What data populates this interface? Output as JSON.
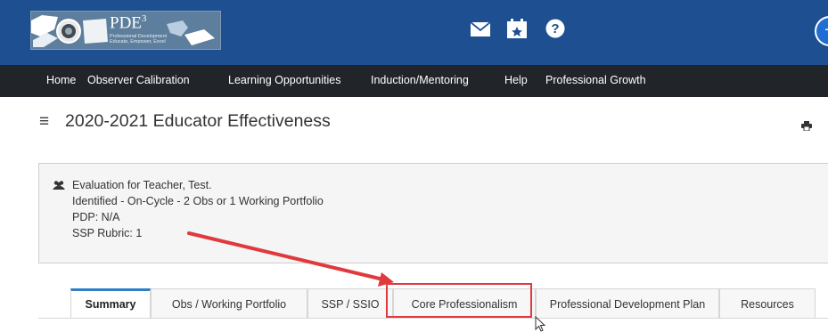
{
  "header": {
    "logo": {
      "title": "PDE",
      "superscript": "3",
      "tagline_line1": "Professional Development",
      "tagline_line2": "Educate, Empower, Excel"
    },
    "icons": [
      "mail-icon",
      "calendar-star-icon",
      "help-icon"
    ],
    "avatar_initial": "T"
  },
  "nav": {
    "items": [
      "Home",
      "Observer Calibration",
      "Learning Opportunities",
      "Induction/Mentoring",
      "Help",
      "Professional Growth"
    ]
  },
  "page": {
    "title": "2020-2021 Educator Effectiveness"
  },
  "evaluation": {
    "heading": "Evaluation for Teacher, Test.",
    "status": "Identified - On-Cycle - 2 Obs or 1 Working Portfolio",
    "pdp": "PDP: N/A",
    "ssp_rubric": "SSP Rubric: 1"
  },
  "tabs": [
    "Summary",
    "Obs / Working Portfolio",
    "SSP / SSIO",
    "Core Professionalism",
    "Professional Development Plan",
    "Resources"
  ],
  "active_tab": "Summary",
  "annotation": {
    "highlighted_tab": "Core Professionalism",
    "color": "#e0393e"
  },
  "colors": {
    "topbar": "#1d4f91",
    "navbar": "#212529",
    "active_tab_accent": "#2e7ec6"
  }
}
